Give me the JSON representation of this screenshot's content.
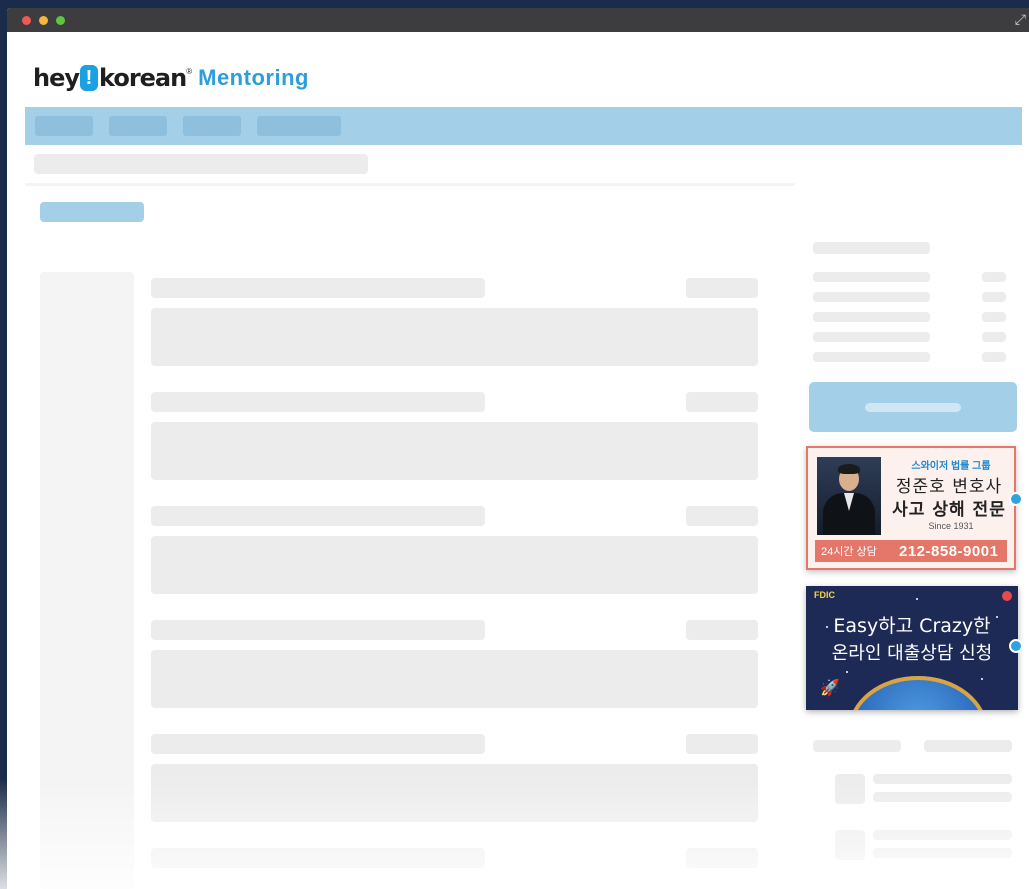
{
  "logo": {
    "hey": "hey",
    "bang": "!",
    "korean": "korean",
    "reg": "®",
    "product": "Mentoring"
  },
  "window": {
    "expand_glyph": "⤢"
  },
  "ads": {
    "lawyer": {
      "group": "스와이저 법률 그룹",
      "name": "정준호 변호사",
      "specialty": "사고 상해 전문",
      "since": "Since 1931",
      "hours_label": "24시간 상담",
      "phone": "212-858-9001"
    },
    "loan": {
      "badge": "FDIC",
      "line1": "Easy하고 Crazy한",
      "line2": "온라인 대출상담 신청"
    }
  },
  "colors": {
    "accent": "#2e9ed8",
    "nav": "#a4cfe8",
    "lawyer_accent": "#e4766a",
    "loan_bg": "#1e2a56"
  }
}
